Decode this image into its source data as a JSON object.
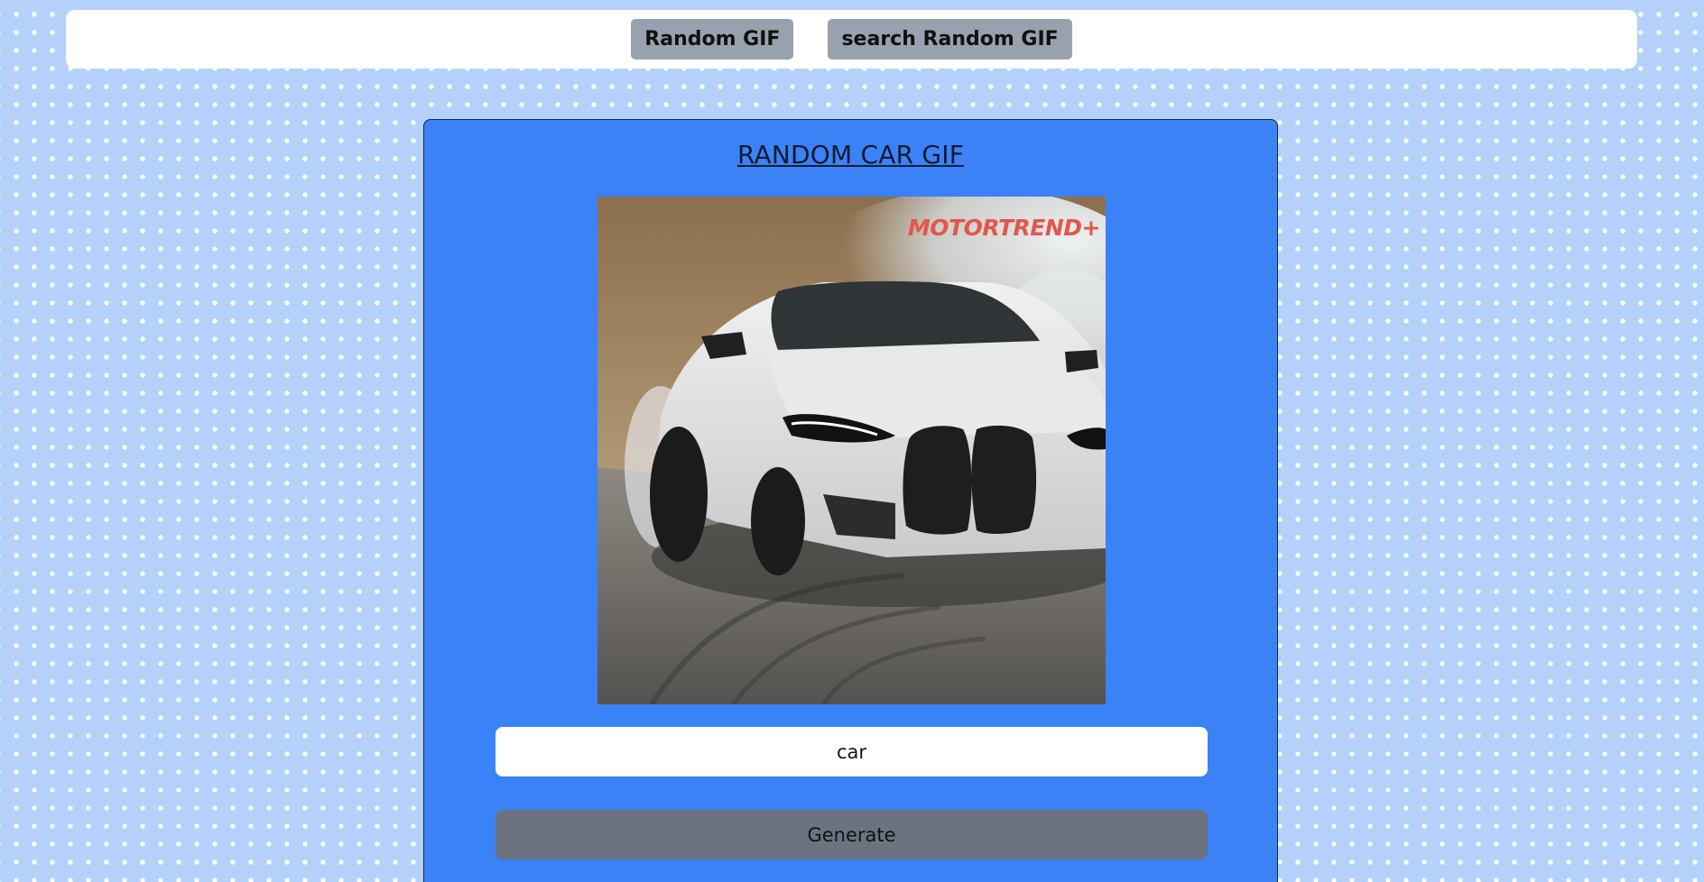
{
  "nav": {
    "random_gif_label": "Random GIF",
    "search_random_gif_label": "search Random GIF"
  },
  "card": {
    "title": "RANDOM CAR GIF",
    "gif": {
      "description": "white car",
      "watermark": "MOTORTREND+"
    },
    "tag_input": {
      "value": "car"
    },
    "generate_label": "Generate"
  },
  "colors": {
    "page_background": "#b3d1fb",
    "card_background": "#3b82f6",
    "nav_button": "#9aa1ae",
    "generate_button": "#6b7280",
    "watermark": "#e2574c"
  }
}
